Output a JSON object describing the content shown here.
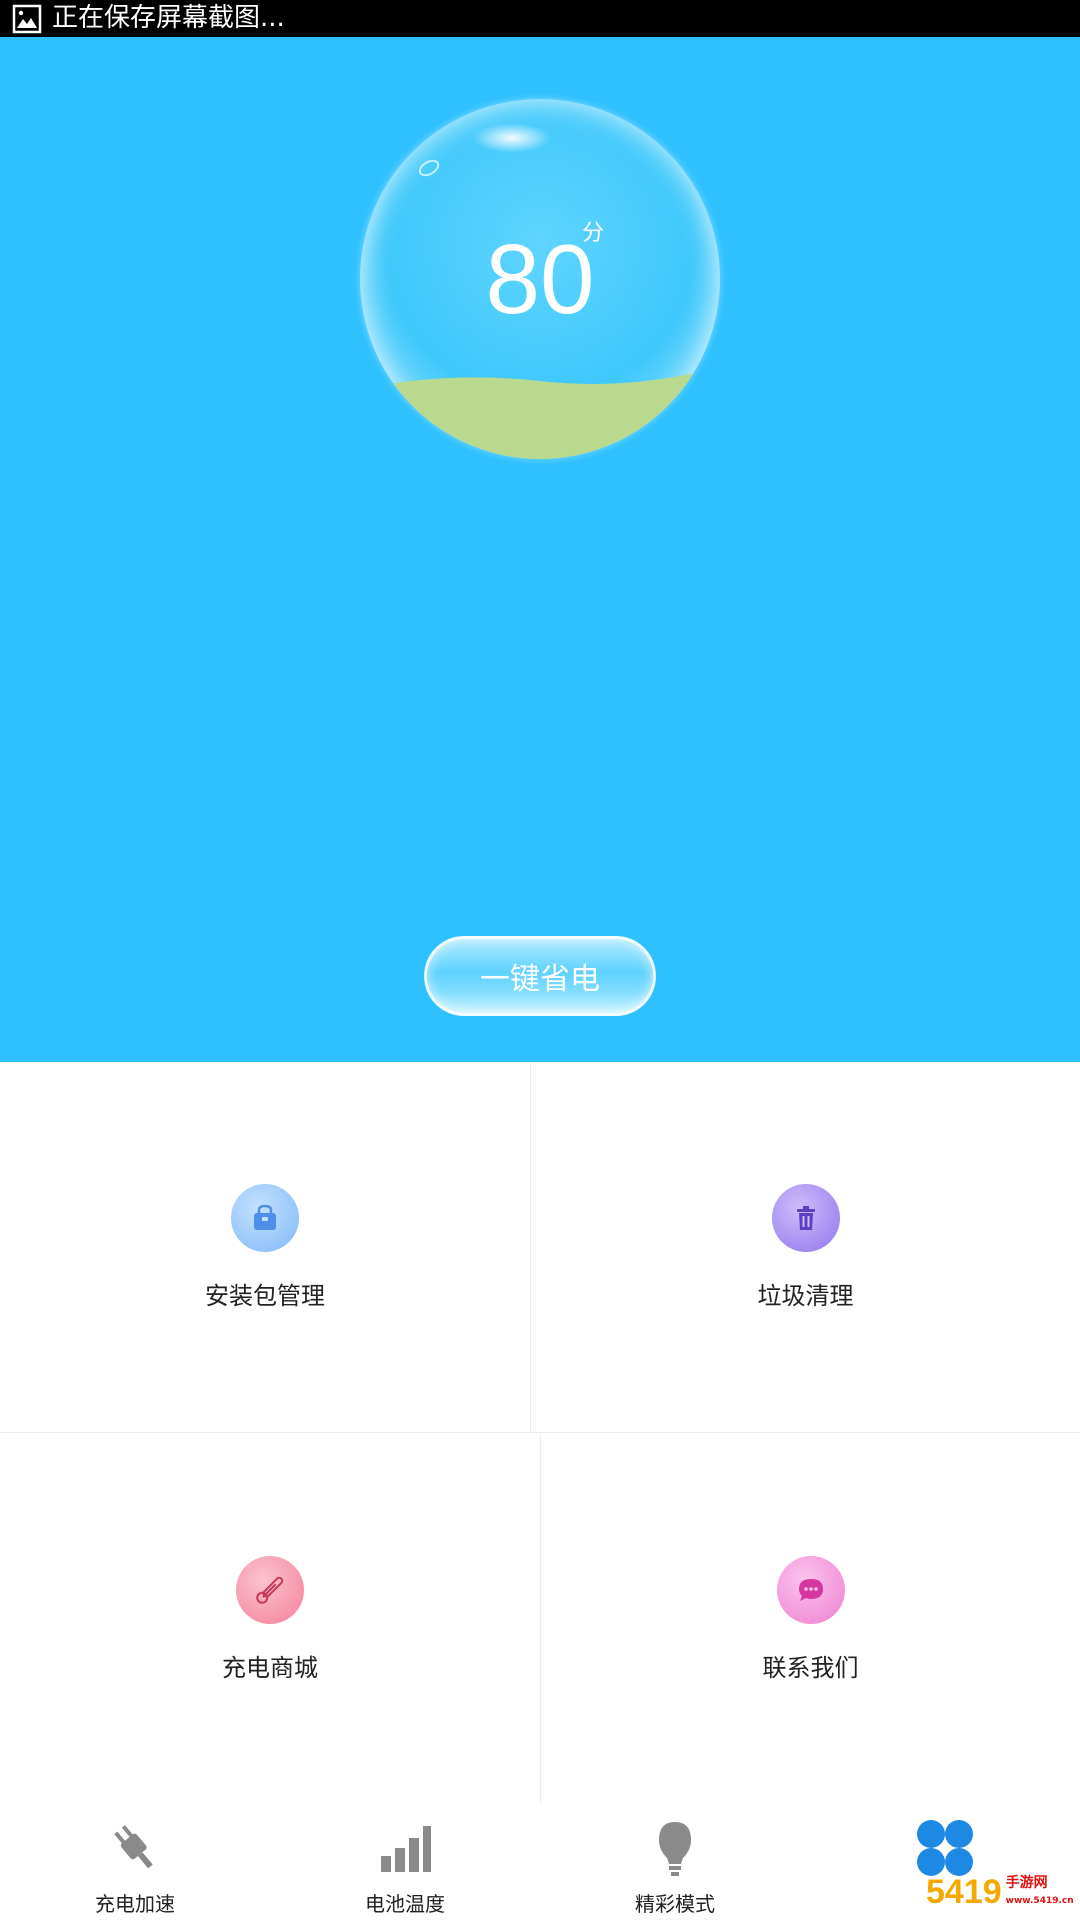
{
  "status_bar": {
    "text": "正在保存屏幕截图..."
  },
  "hero": {
    "score": "80",
    "score_unit": "分",
    "save_button_label": "一键省电",
    "background_color": "#2ec0ff",
    "score_level": 0.8
  },
  "grid": {
    "tiles": [
      {
        "label": "安装包管理",
        "icon": "package-bag-icon",
        "color": "#8ec6ff"
      },
      {
        "label": "垃圾清理",
        "icon": "trash-icon",
        "color": "#a68af2"
      },
      {
        "label": "充电商城",
        "icon": "thermometer-icon",
        "color": "#f79ab0"
      },
      {
        "label": "联系我们",
        "icon": "chat-bubble-icon",
        "color": "#f28fd6"
      }
    ]
  },
  "bottom_nav": {
    "items": [
      {
        "label": "充电加速",
        "icon": "plug-icon"
      },
      {
        "label": "电池温度",
        "icon": "bar-chart-icon"
      },
      {
        "label": "精彩模式",
        "icon": "lightbulb-icon"
      },
      {
        "label": "",
        "icon": "clover-icon",
        "color": "#1e88e5"
      }
    ]
  },
  "watermark": {
    "number": "5419",
    "text": "手游网",
    "domain": "www.5419.cn"
  }
}
